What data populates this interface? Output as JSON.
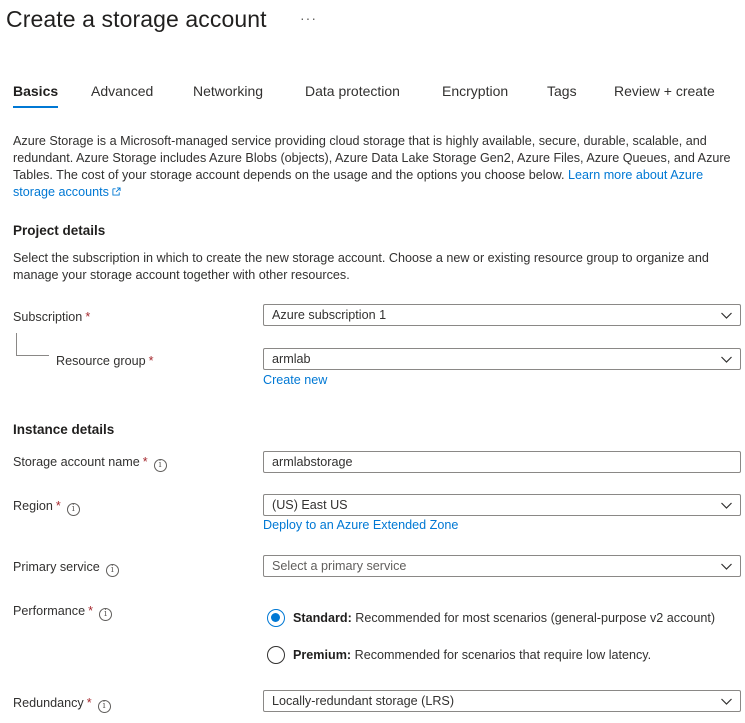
{
  "page": {
    "title": "Create a storage account",
    "more": "···"
  },
  "tabs": [
    {
      "label": "Basics",
      "active": true
    },
    {
      "label": "Advanced"
    },
    {
      "label": "Networking"
    },
    {
      "label": "Data protection"
    },
    {
      "label": "Encryption"
    },
    {
      "label": "Tags"
    },
    {
      "label": "Review + create"
    }
  ],
  "intro": {
    "text": "Azure Storage is a Microsoft-managed service providing cloud storage that is highly available, secure, durable, scalable, and redundant. Azure Storage includes Azure Blobs (objects), Azure Data Lake Storage Gen2, Azure Files, Azure Queues, and Azure Tables. The cost of your storage account depends on the usage and the options you choose below.",
    "link": "Learn more about Azure storage accounts"
  },
  "project": {
    "heading": "Project details",
    "description": "Select the subscription in which to create the new storage account. Choose a new or existing resource group to organize and manage your storage account together with other resources.",
    "subscription_label": "Subscription",
    "subscription_value": "Azure subscription 1",
    "resource_group_label": "Resource group",
    "resource_group_value": "armlab",
    "create_new": "Create new"
  },
  "instance": {
    "heading": "Instance details",
    "name_label": "Storage account name",
    "name_value": "armlabstorage",
    "region_label": "Region",
    "region_value": "(US) East US",
    "region_link": "Deploy to an Azure Extended Zone",
    "primary_label": "Primary service",
    "primary_placeholder": "Select a primary service",
    "performance_label": "Performance",
    "standard_title": "Standard:",
    "standard_desc": "Recommended for most scenarios (general-purpose v2 account)",
    "premium_title": "Premium:",
    "premium_desc": "Recommended for scenarios that require low latency.",
    "redundancy_label": "Redundancy",
    "redundancy_value": "Locally-redundant storage (LRS)"
  },
  "symbols": {
    "required": "*",
    "info": "i"
  },
  "colors": {
    "accent": "#0078d4",
    "required": "#a4262c"
  }
}
